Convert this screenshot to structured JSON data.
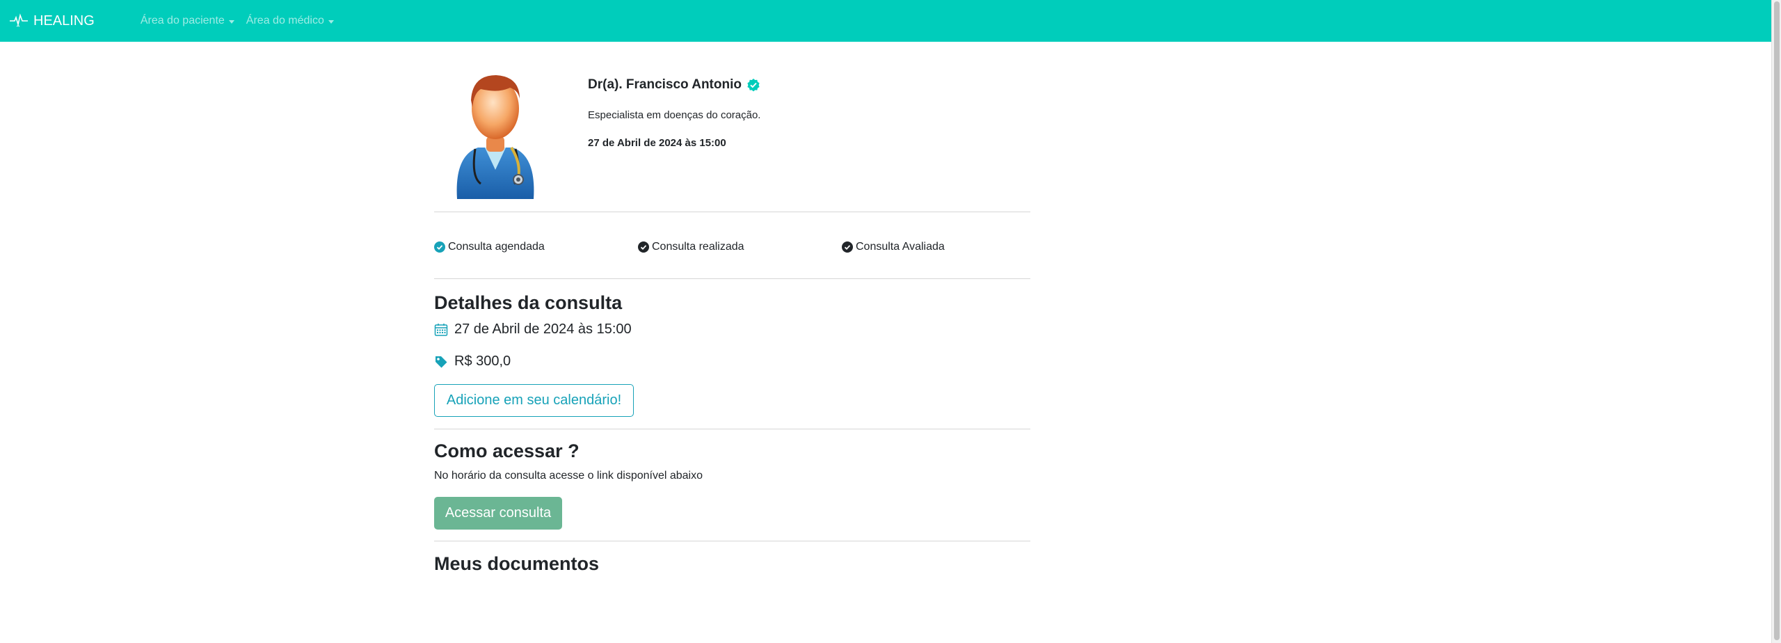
{
  "nav": {
    "brand": "HEALING",
    "items": [
      {
        "label": "Área do paciente"
      },
      {
        "label": "Área do médico"
      }
    ]
  },
  "doctor": {
    "name": "Dr(a). Francisco Antonio",
    "specialty": "Especialista em doenças do coração.",
    "datetime": "27 de Abril de 2024 às 15:00"
  },
  "statuses": [
    {
      "label": "Consulta agendada",
      "color": "#17a2b8"
    },
    {
      "label": "Consulta realizada",
      "color": "#212529"
    },
    {
      "label": "Consulta Avaliada",
      "color": "#212529"
    }
  ],
  "details": {
    "title": "Detalhes da consulta",
    "date": "27 de Abril de 2024 às 15:00",
    "price": "R$ 300,0",
    "calendar_button": "Adicione em seu calendário!"
  },
  "access": {
    "title": "Como acessar ?",
    "text": "No horário da consulta acesse o link disponível abaixo",
    "button": "Acessar consulta"
  },
  "documents": {
    "title": "Meus documentos"
  },
  "colors": {
    "navbar": "#00cdbb",
    "accent": "#17a2b8",
    "access_button": "#6bb694",
    "verified": "#00cdbb"
  }
}
